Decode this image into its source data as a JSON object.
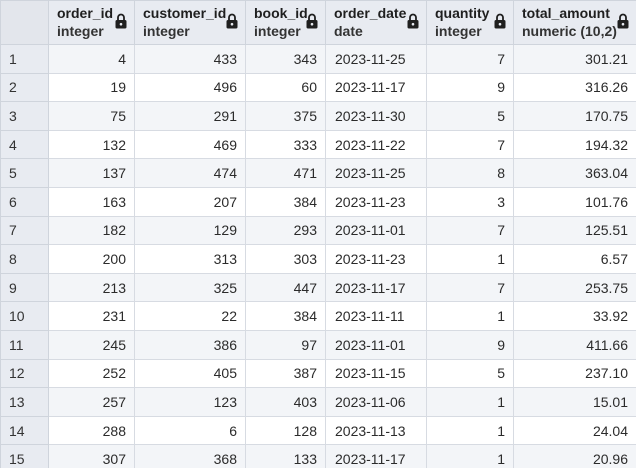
{
  "columns": [
    {
      "name": "order_id",
      "type": "integer"
    },
    {
      "name": "customer_id",
      "type": "integer"
    },
    {
      "name": "book_id",
      "type": "integer"
    },
    {
      "name": "order_date",
      "type": "date"
    },
    {
      "name": "quantity",
      "type": "integer"
    },
    {
      "name": "total_amount",
      "type": "numeric (10,2)"
    }
  ],
  "rows": [
    {
      "n": "1",
      "cells": [
        "4",
        "433",
        "343",
        "2023-11-25",
        "7",
        "301.21"
      ]
    },
    {
      "n": "2",
      "cells": [
        "19",
        "496",
        "60",
        "2023-11-17",
        "9",
        "316.26"
      ]
    },
    {
      "n": "3",
      "cells": [
        "75",
        "291",
        "375",
        "2023-11-30",
        "5",
        "170.75"
      ]
    },
    {
      "n": "4",
      "cells": [
        "132",
        "469",
        "333",
        "2023-11-22",
        "7",
        "194.32"
      ]
    },
    {
      "n": "5",
      "cells": [
        "137",
        "474",
        "471",
        "2023-11-25",
        "8",
        "363.04"
      ]
    },
    {
      "n": "6",
      "cells": [
        "163",
        "207",
        "384",
        "2023-11-23",
        "3",
        "101.76"
      ]
    },
    {
      "n": "7",
      "cells": [
        "182",
        "129",
        "293",
        "2023-11-01",
        "7",
        "125.51"
      ]
    },
    {
      "n": "8",
      "cells": [
        "200",
        "313",
        "303",
        "2023-11-23",
        "1",
        "6.57"
      ]
    },
    {
      "n": "9",
      "cells": [
        "213",
        "325",
        "447",
        "2023-11-17",
        "7",
        "253.75"
      ]
    },
    {
      "n": "10",
      "cells": [
        "231",
        "22",
        "384",
        "2023-11-11",
        "1",
        "33.92"
      ]
    },
    {
      "n": "11",
      "cells": [
        "245",
        "386",
        "97",
        "2023-11-01",
        "9",
        "411.66"
      ]
    },
    {
      "n": "12",
      "cells": [
        "252",
        "405",
        "387",
        "2023-11-15",
        "5",
        "237.10"
      ]
    },
    {
      "n": "13",
      "cells": [
        "257",
        "123",
        "403",
        "2023-11-06",
        "1",
        "15.01"
      ]
    },
    {
      "n": "14",
      "cells": [
        "288",
        "6",
        "128",
        "2023-11-13",
        "1",
        "24.04"
      ]
    },
    {
      "n": "15",
      "cells": [
        "307",
        "368",
        "133",
        "2023-11-17",
        "1",
        "20.96"
      ]
    }
  ],
  "icons": {
    "column_lock": "lock-icon"
  },
  "colors": {
    "header_bg": "#e8ebf1",
    "row_alt_bg": "#f3f5f8",
    "border": "#d7dbe2"
  }
}
